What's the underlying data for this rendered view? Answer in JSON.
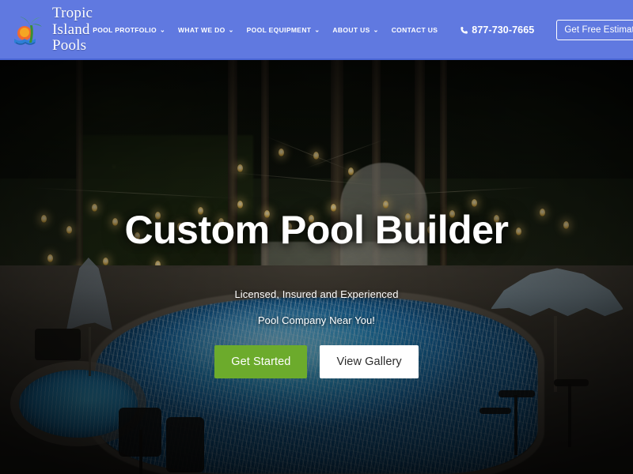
{
  "header": {
    "brand": {
      "line1": "Tropic",
      "line2": "Island Pools",
      "logo_icon": "palm-tree-sunset-logo"
    },
    "nav_items": [
      {
        "label": "POOL PROTFOLIO",
        "has_dropdown": true,
        "caret": "⌄"
      },
      {
        "label": "WHAT WE DO",
        "has_dropdown": true,
        "caret": "⌄"
      },
      {
        "label": "POOL EQUIPMENT",
        "has_dropdown": true,
        "caret": "⌄"
      },
      {
        "label": "ABOUT US",
        "has_dropdown": true,
        "caret": "⌄"
      },
      {
        "label": "CONTACT US",
        "has_dropdown": false,
        "caret": ""
      }
    ],
    "phone": {
      "number": "877-730-7665",
      "icon": "phone-icon"
    },
    "estimate_button": "Get Free Estimate",
    "background_color": "#6079e0"
  },
  "hero": {
    "title": "Custom Pool Builder",
    "subtitle_line1": "Licensed, Insured and Experienced",
    "subtitle_line2": "Pool Company Near You!",
    "primary_button": "Get Started",
    "secondary_button": "View Gallery",
    "primary_button_color": "#6cab2c",
    "secondary_button_color": "#ffffff",
    "background_description": "night-time backyard swimming pool with string lights"
  }
}
